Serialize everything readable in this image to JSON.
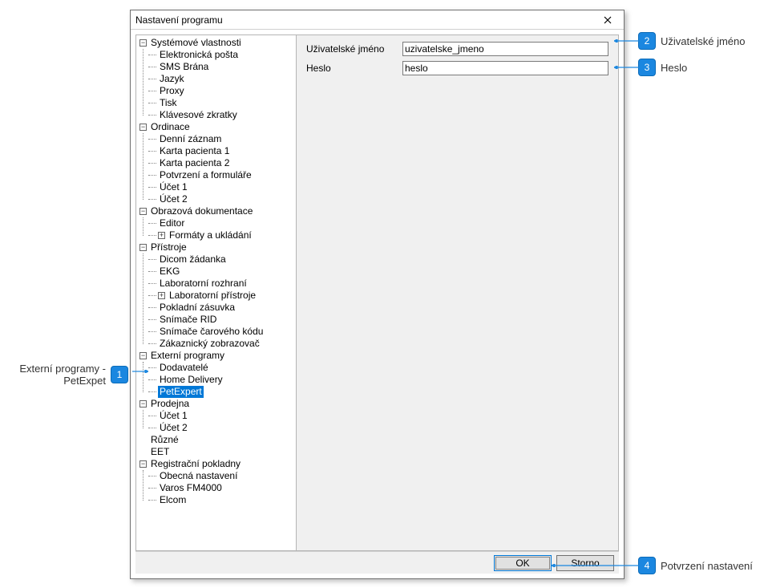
{
  "dialog": {
    "title": "Nastavení programu",
    "close_icon": "close"
  },
  "form": {
    "username_label": "Uživatelské jméno",
    "username_value": "uzivatelske_jmeno",
    "password_label": "Heslo",
    "password_value": "heslo"
  },
  "buttons": {
    "ok": "OK",
    "cancel": "Storno"
  },
  "tree": {
    "sys": "Systémové vlastnosti",
    "sys_mail": "Elektronická pošta",
    "sys_sms": "SMS Brána",
    "sys_lang": "Jazyk",
    "sys_proxy": "Proxy",
    "sys_print": "Tisk",
    "sys_short": "Klávesové zkratky",
    "ord": "Ordinace",
    "ord_denni": "Denní záznam",
    "ord_karta1": "Karta pacienta 1",
    "ord_karta2": "Karta pacienta 2",
    "ord_forms": "Potvrzení a formuláře",
    "ord_ucet1": "Účet 1",
    "ord_ucet2": "Účet 2",
    "img": "Obrazová dokumentace",
    "img_editor": "Editor",
    "img_fmt": "Formáty a ukládání",
    "pri": "Přístroje",
    "pri_dicom": "Dicom žádanka",
    "pri_ekg": "EKG",
    "pri_lab": "Laboratorní rozhraní",
    "pri_labdev": "Laboratorní přístroje",
    "pri_zas": "Pokladní zásuvka",
    "pri_rid": "Snímače RID",
    "pri_bar": "Snímače čarového kódu",
    "pri_zobr": "Zákaznický zobrazovač",
    "ext": "Externí programy",
    "ext_dod": "Dodavatelé",
    "ext_home": "Home Delivery",
    "ext_pet": "PetExpert",
    "shop": "Prodejna",
    "shop_u1": "Účet 1",
    "shop_u2": "Účet 2",
    "misc": "Různé",
    "eet": "EET",
    "reg": "Registrační pokladny",
    "reg_obecna": "Obecná nastavení",
    "reg_varos": "Varos FM4000",
    "reg_elcom": "Elcom"
  },
  "callouts": {
    "c1_label": "Externí programy - PetExpet",
    "c1_num": "1",
    "c2_label": "Uživatelské jméno",
    "c2_num": "2",
    "c3_label": "Heslo",
    "c3_num": "3",
    "c4_label": "Potvrzení nastavení",
    "c4_num": "4"
  }
}
